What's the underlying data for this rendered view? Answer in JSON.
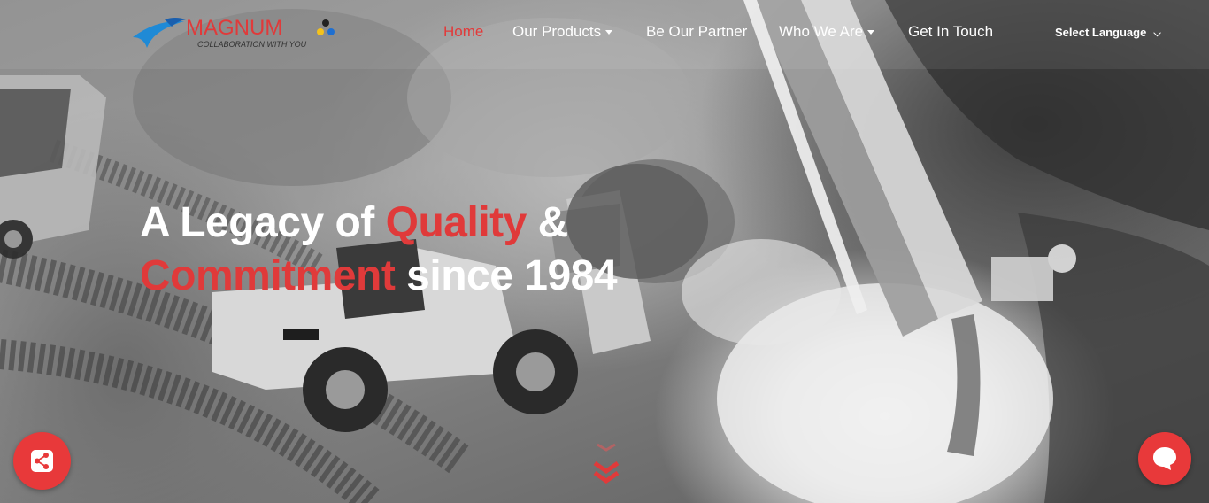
{
  "brand": {
    "name": "MAGNUM",
    "tagline": "COLLABORATION WITH YOU"
  },
  "nav": {
    "items": [
      {
        "label": "Home",
        "active": true,
        "dropdown": false
      },
      {
        "label": "Our Products",
        "active": false,
        "dropdown": true
      },
      {
        "label": "Be Our Partner",
        "active": false,
        "dropdown": false
      },
      {
        "label": "Who We Are",
        "active": false,
        "dropdown": true
      },
      {
        "label": "Get In Touch",
        "active": false,
        "dropdown": false
      }
    ]
  },
  "language": {
    "label": "Select Language",
    "icon": "chevron-down-icon"
  },
  "hero": {
    "line1_a": "A Legacy of ",
    "line1_b": "Quality",
    "line1_c": " &",
    "line2_a": "Commitment",
    "line2_b": " since 1984"
  },
  "buttons": {
    "share_icon": "share-icon",
    "chat_icon": "chat-icon",
    "scroll_icon": "double-chevron-down-icon"
  },
  "colors": {
    "accent": "#e03a3a",
    "text": "#ffffff"
  }
}
